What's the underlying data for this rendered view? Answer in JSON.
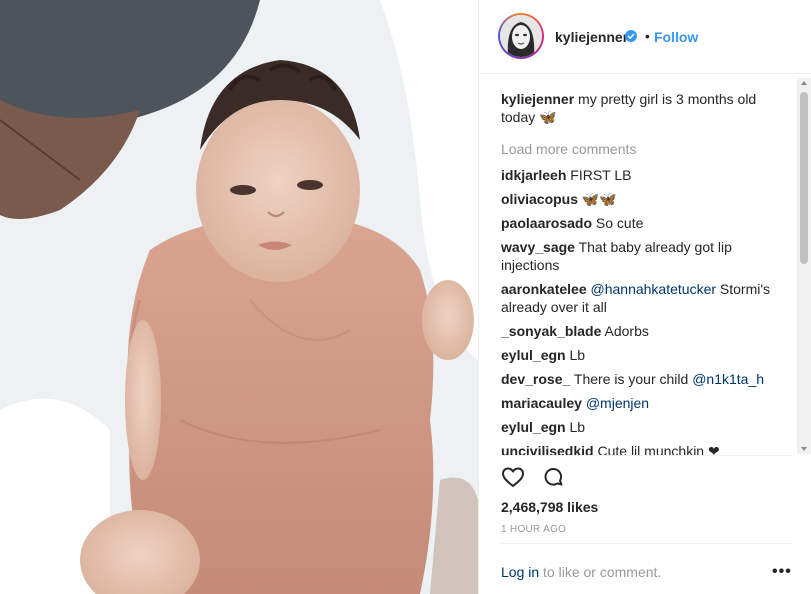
{
  "post": {
    "username": "kyliejenner",
    "separator": "•",
    "follow_label": "Follow",
    "caption": {
      "user": "kyliejenner",
      "text": "my pretty girl is 3 months old today 🦋"
    },
    "load_more": "Load more comments",
    "comments": [
      {
        "user": "idkjarleeh",
        "text": "FIRST LB"
      },
      {
        "user": "oliviacopus",
        "text": "🦋🦋"
      },
      {
        "user": "paolaarosado",
        "text": "So cute"
      },
      {
        "user": "wavy_sage",
        "text": "That baby already got lip injections"
      },
      {
        "user": "aaronkatelee",
        "mention": "@hannahkatetucker",
        "text": "Stormi's already over it all"
      },
      {
        "user": "_sonyak_blade",
        "text": "Adorbs"
      },
      {
        "user": "eylul_egn",
        "text": "Lb"
      },
      {
        "user": "dev_rose_",
        "text": "There is your child",
        "mention_after": "@n1k1ta_h"
      },
      {
        "user": "mariacauley",
        "mention": "@mjenjen",
        "text": ""
      },
      {
        "user": "eylul_egn",
        "text": "Lb"
      },
      {
        "user": "uncivilisedkid",
        "text": "Cute lil munchkin ❤"
      }
    ],
    "likes": "2,468,798 likes",
    "time": "1 HOUR AGO",
    "login_link": "Log in",
    "login_rest": " to like or comment.",
    "more_label": "•••"
  },
  "icons": {
    "verified": "verified-badge-icon",
    "like": "heart-icon",
    "comment": "comment-icon",
    "more": "more-options-icon"
  },
  "colors": {
    "link": "#3897f0",
    "mention": "#003569",
    "muted": "#999999",
    "text": "#262626"
  }
}
